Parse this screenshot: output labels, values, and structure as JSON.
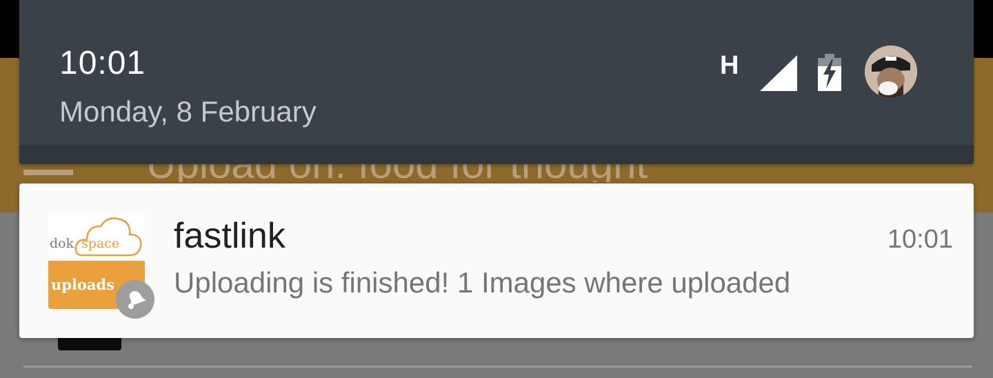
{
  "status_bar": {
    "time": "10:01",
    "date": "Monday, 8 February",
    "network_type": "H",
    "signal_icon": "signal-full-icon",
    "battery_icon": "battery-charging-icon"
  },
  "background_app": {
    "title": "Upload on: food for thought",
    "menu_icon": "hamburger-icon"
  },
  "notification": {
    "app_name": "fastlink",
    "time": "10:01",
    "message": "Uploading is finished! 1 Images where uploaded",
    "icon": {
      "logo_word_1": "dok",
      "logo_word_2": "space",
      "logo_word_3": "uploads"
    },
    "badge_icon": "notification-bell-icon"
  },
  "colors": {
    "header_bg": "#3a4149",
    "app_bar_bg": "#8e6a2a",
    "logo_orange": "#eba03e",
    "card_bg": "#fafafa"
  }
}
